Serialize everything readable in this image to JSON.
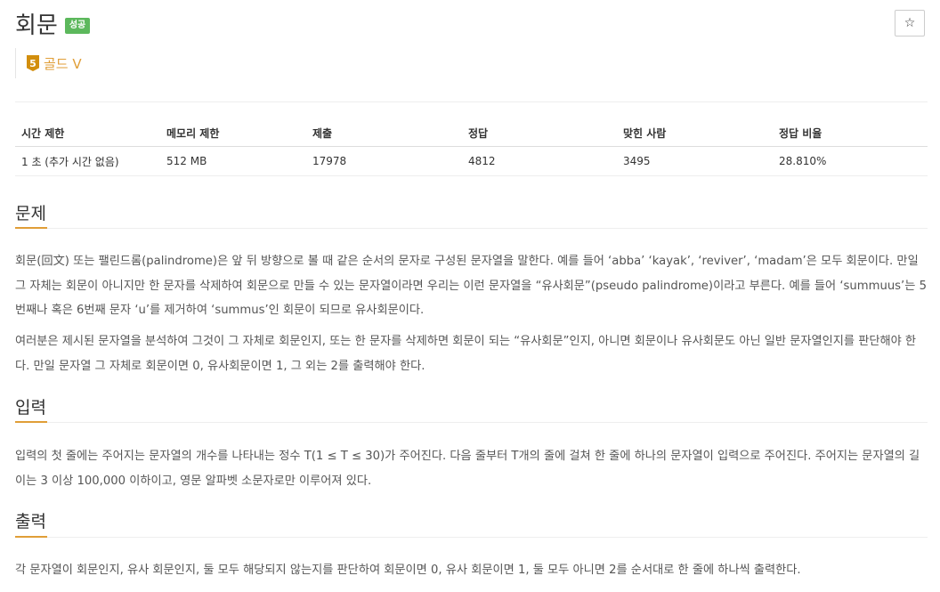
{
  "problem": {
    "title": "회문",
    "status_badge": "성공",
    "star_icon": "☆",
    "tier_number": "5",
    "tier_label": "골드 V",
    "tier_color": "#d28e0d"
  },
  "stats": {
    "headers": [
      "시간 제한",
      "메모리 제한",
      "제출",
      "정답",
      "맞힌 사람",
      "정답 비율"
    ],
    "values": [
      "1 초 (추가 시간 없음)",
      "512 MB",
      "17978",
      "4812",
      "3495",
      "28.810%"
    ]
  },
  "sections": {
    "problem": {
      "heading": "문제",
      "p1": "회문(回文) 또는 팰린드롬(palindrome)은 앞 뒤 방향으로 볼 때 같은 순서의 문자로 구성된 문자열을 말한다. 예를 들어 ‘abba’ ‘kayak’, ‘reviver’, ‘madam’은 모두 회문이다. 만일 그 자체는 회문이 아니지만 한 문자를 삭제하여 회문으로 만들 수 있는 문자열이라면 우리는 이런 문자열을 “유사회문”(pseudo palindrome)이라고 부른다. 예를 들어 ‘summuus’는 5번째나 혹은 6번째 문자 ‘u’를 제거하여 ‘summus’인 회문이 되므로 유사회문이다.",
      "p2": "여러분은 제시된 문자열을 분석하여 그것이 그 자체로 회문인지, 또는 한 문자를 삭제하면 회문이 되는 “유사회문”인지, 아니면 회문이나 유사회문도 아닌 일반 문자열인지를 판단해야 한다. 만일 문자열 그 자체로 회문이면 0, 유사회문이면 1, 그 외는 2를 출력해야 한다."
    },
    "input": {
      "heading": "입력",
      "p1": "입력의 첫 줄에는 주어지는 문자열의 개수를 나타내는 정수 T(1 ≤ T ≤ 30)가 주어진다. 다음 줄부터 T개의 줄에 걸쳐 한 줄에 하나의 문자열이 입력으로 주어진다. 주어지는 문자열의 길이는 3 이상 100,000 이하이고, 영문 알파벳 소문자로만 이루어져 있다."
    },
    "output": {
      "heading": "출력",
      "p1": "각 문자열이 회문인지, 유사 회문인지, 둘 모두 해당되지 않는지를 판단하여 회문이면 0, 유사 회문이면 1, 둘 모두 아니면 2를 순서대로 한 줄에 하나씩 출력한다."
    }
  },
  "colors": {
    "accent": "#e09e37",
    "success": "#5cb85c"
  }
}
